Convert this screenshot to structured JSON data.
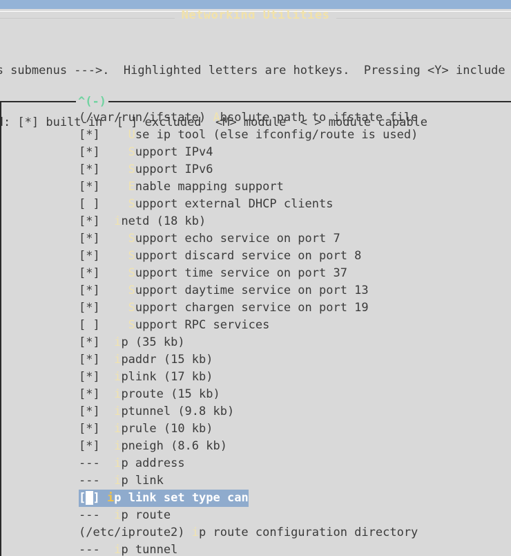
{
  "window": {
    "titlebar_color": "#94b3d7",
    "background_color": "#d9d9d9"
  },
  "dialog": {
    "title": "Networking Utilities",
    "title_color": "#f2e2a8"
  },
  "help": {
    "line1": "ects submenus --->.  Highlighted letters are hotkeys.  Pressing <Y> include",
    "line2": "gend: [*] built-in  [ ] excluded  <M> module  < > module capable"
  },
  "panel": {
    "scroll_up_marker": "^(-)",
    "marker_color": "#6fd3a0",
    "selection_bg": "#8fabcd",
    "selection_fg": "#ffffff",
    "hotkey_color": "#f0e3b0",
    "text_color": "#3b3b3b"
  },
  "menu": {
    "items": [
      {
        "prefix": "(/var/run/ifstate) ",
        "hot": "A",
        "label": "bsolute path to ifstate file",
        "selected": false
      },
      {
        "prefix": "[*]    ",
        "hot": "U",
        "label": "se ip tool (else ifconfig/route is used)",
        "selected": false
      },
      {
        "prefix": "[*]    ",
        "hot": "S",
        "label": "upport IPv4",
        "selected": false
      },
      {
        "prefix": "[*]    ",
        "hot": "S",
        "label": "upport IPv6",
        "selected": false
      },
      {
        "prefix": "[*]    ",
        "hot": "E",
        "label": "nable mapping support",
        "selected": false
      },
      {
        "prefix": "[ ]    ",
        "hot": "S",
        "label": "upport external DHCP clients",
        "selected": false
      },
      {
        "prefix": "[*]  ",
        "hot": "i",
        "label": "netd (18 kb)",
        "selected": false
      },
      {
        "prefix": "[*]    ",
        "hot": "S",
        "label": "upport echo service on port 7",
        "selected": false
      },
      {
        "prefix": "[*]    ",
        "hot": "S",
        "label": "upport discard service on port 8",
        "selected": false
      },
      {
        "prefix": "[*]    ",
        "hot": "S",
        "label": "upport time service on port 37",
        "selected": false
      },
      {
        "prefix": "[*]    ",
        "hot": "S",
        "label": "upport daytime service on port 13",
        "selected": false
      },
      {
        "prefix": "[*]    ",
        "hot": "S",
        "label": "upport chargen service on port 19",
        "selected": false
      },
      {
        "prefix": "[ ]    ",
        "hot": "S",
        "label": "upport RPC services",
        "selected": false
      },
      {
        "prefix": "[*]  ",
        "hot": "i",
        "label": "p (35 kb)",
        "selected": false
      },
      {
        "prefix": "[*]  ",
        "hot": "i",
        "label": "paddr (15 kb)",
        "selected": false
      },
      {
        "prefix": "[*]  ",
        "hot": "i",
        "label": "plink (17 kb)",
        "selected": false
      },
      {
        "prefix": "[*]  ",
        "hot": "i",
        "label": "proute (15 kb)",
        "selected": false
      },
      {
        "prefix": "[*]  ",
        "hot": "i",
        "label": "ptunnel (9.8 kb)",
        "selected": false
      },
      {
        "prefix": "[*]  ",
        "hot": "i",
        "label": "prule (10 kb)",
        "selected": false
      },
      {
        "prefix": "[*]  ",
        "hot": "i",
        "label": "pneigh (8.6 kb)",
        "selected": false
      },
      {
        "prefix": "---  ",
        "hot": "i",
        "label": "p address",
        "selected": false
      },
      {
        "prefix": "---  ",
        "hot": "i",
        "label": "p link",
        "selected": false
      },
      {
        "prefix": "[ ] ",
        "hot": "i",
        "label": "p link set type can",
        "selected": true
      },
      {
        "prefix": "---  ",
        "hot": "i",
        "label": "p route",
        "selected": false
      },
      {
        "prefix": "(/etc/iproute2) ",
        "hot": "i",
        "label": "p route configuration directory",
        "selected": false
      },
      {
        "prefix": "---  ",
        "hot": "i",
        "label": "p tunnel",
        "selected": false
      }
    ]
  }
}
